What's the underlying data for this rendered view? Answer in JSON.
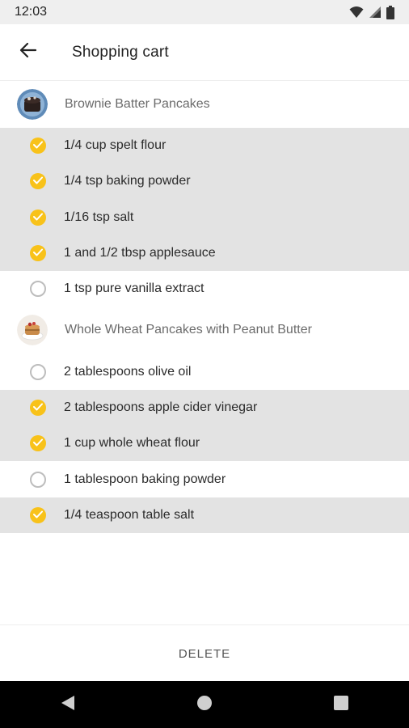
{
  "status_bar": {
    "time": "12:03"
  },
  "app_bar": {
    "title": "Shopping cart"
  },
  "colors": {
    "accent": "#f8c21a",
    "checked_row": "#e3e3e3"
  },
  "recipes": [
    {
      "title": "Brownie Batter Pancakes",
      "thumbnail_icon": "brownie-pancake-photo",
      "ingredients": [
        {
          "text": "1/4 cup spelt flour",
          "checked": true
        },
        {
          "text": "1/4 tsp baking powder",
          "checked": true
        },
        {
          "text": "1/16 tsp salt",
          "checked": true
        },
        {
          "text": "1 and 1/2 tbsp applesauce",
          "checked": true
        },
        {
          "text": "1 tsp pure vanilla extract",
          "checked": false
        }
      ]
    },
    {
      "title": "Whole Wheat Pancakes with Peanut Butter",
      "thumbnail_icon": "peanut-butter-pancake-photo",
      "ingredients": [
        {
          "text": "2 tablespoons olive oil",
          "checked": false
        },
        {
          "text": "2 tablespoons apple cider vinegar",
          "checked": true
        },
        {
          "text": "1 cup whole wheat flour",
          "checked": true
        },
        {
          "text": "1 tablespoon baking powder",
          "checked": false
        },
        {
          "text": "1/4 teaspoon table salt",
          "checked": true
        }
      ]
    }
  ],
  "actions": {
    "delete_label": "DELETE"
  },
  "icons": {
    "back": "arrow-left-icon",
    "wifi": "wifi-icon",
    "signal": "signal-icon",
    "battery": "battery-icon",
    "nav_back": "nav-back-icon",
    "nav_home": "nav-home-icon",
    "nav_recents": "nav-recents-icon",
    "check": "check-icon"
  }
}
